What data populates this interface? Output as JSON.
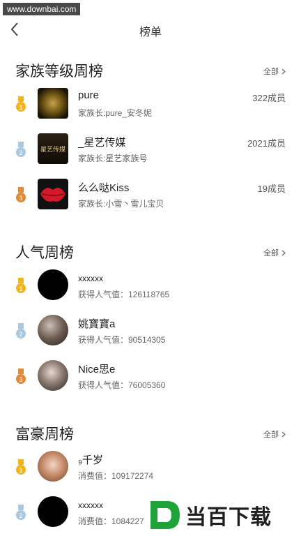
{
  "watermark": "www.downbai.com",
  "header": {
    "title": "榜单"
  },
  "family": {
    "title": "家族等级周榜",
    "all_label": "全部",
    "items": [
      {
        "name": "pure",
        "sub": "家族长:pure_安冬妮",
        "count": "322成员"
      },
      {
        "name": "_星艺传媒",
        "sub": "家族长:星艺家族号",
        "count": "2021成员"
      },
      {
        "name": "么么哒Kiss",
        "sub": "家族长:小雪丶雪儿宝贝",
        "count": "19成员"
      }
    ]
  },
  "popularity": {
    "title": "人气周榜",
    "all_label": "全部",
    "items": [
      {
        "name": "xxxxxx",
        "sub": "获得人气值：126118765"
      },
      {
        "name": "姚寶寶a",
        "sub": "获得人气值：90514305"
      },
      {
        "name": "Nice思e",
        "sub": "获得人气值：76005360"
      }
    ]
  },
  "rich": {
    "title": "富豪周榜",
    "all_label": "全部",
    "items": [
      {
        "name": "₉千岁",
        "sub": "消费值：109172274"
      },
      {
        "name": "xxxxxx",
        "sub": "消费值：1084227"
      }
    ]
  },
  "brand_watermark": "当百下载",
  "colors": {
    "gold": "#f2b51c",
    "silver": "#a9c7df",
    "bronze": "#e08a3a"
  }
}
